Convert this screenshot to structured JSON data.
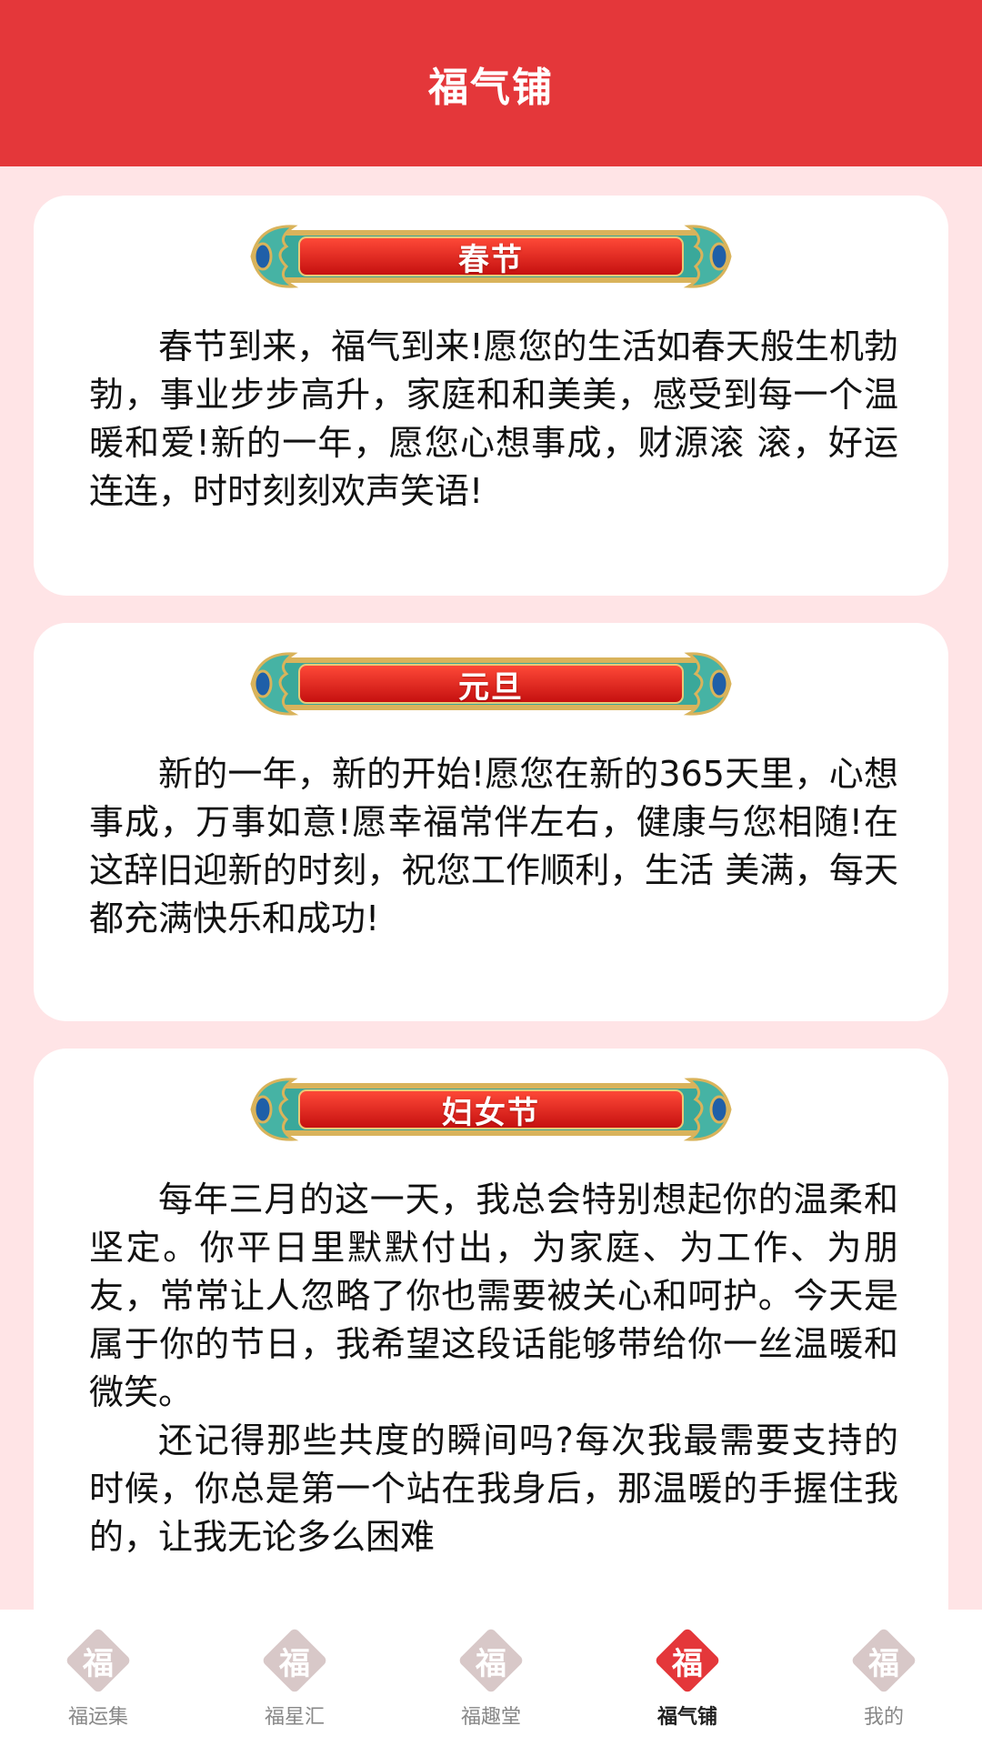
{
  "header": {
    "title": "福气铺"
  },
  "cards": [
    {
      "banner": "春节",
      "paragraphs": [
        "春节到来，福气到来!愿您的生活如春天般生机勃勃，事业步步高升，家庭和和美美，感受到每一个温暖和爱!新的一年，愿您心想事成，财源滚 滚，好运连连，时时刻刻欢声笑语!"
      ]
    },
    {
      "banner": "元旦",
      "paragraphs": [
        "新的一年，新的开始!愿您在新的365天里，心想事成，万事如意!愿幸福常伴左右，健康与您相随!在这辞旧迎新的时刻，祝您工作顺利，生活 美满，每天都充满快乐和成功!"
      ]
    },
    {
      "banner": "妇女节",
      "paragraphs": [
        "每年三月的这一天，我总会特别想起你的温柔和坚定。你平日里默默付出，为家庭、为工作、为朋友，常常让人忽略了你也需要被关心和呵护。今天是属于你的节日，我希望这段话能够带给你一丝温暖和微笑。",
        "还记得那些共度的瞬间吗?每次我最需要支持的时候，你总是第一个站在我身后，那温暖的手握住我的，让我无论多么困难"
      ]
    }
  ],
  "tabbar": {
    "items": [
      {
        "label": "福运集",
        "glyph": "福",
        "icon": "fu-diamond-icon"
      },
      {
        "label": "福星汇",
        "glyph": "福",
        "icon": "fu-diamond-icon"
      },
      {
        "label": "福趣堂",
        "glyph": "福",
        "icon": "fu-diamond-icon"
      },
      {
        "label": "福气铺",
        "glyph": "福",
        "icon": "fu-diamond-icon"
      },
      {
        "label": "我的",
        "glyph": "福",
        "icon": "fu-diamond-icon"
      }
    ],
    "active_index": 3,
    "active_color": "#e4373a",
    "inactive_color": "#d8c8c8"
  },
  "colors": {
    "header_bg": "#e4373a",
    "page_bg": "#ffe4e6",
    "banner_red": "#e8261c",
    "banner_teal": "#3aa89a",
    "banner_gold": "#d9b35b"
  }
}
